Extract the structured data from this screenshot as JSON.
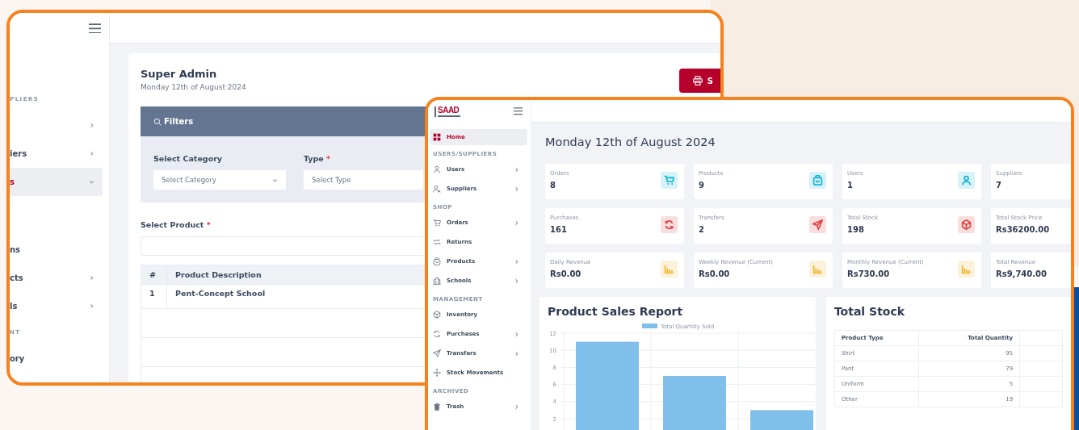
{
  "back_window": {
    "sidebar": {
      "items": [
        {
          "kind": "section",
          "label": "PLIERS"
        },
        {
          "kind": "item",
          "has_submenu": true,
          "expanded": false,
          "selected": false
        },
        {
          "kind": "item",
          "label": "iers",
          "has_submenu": true,
          "expanded": false,
          "selected": false
        },
        {
          "kind": "item",
          "label": "s",
          "has_submenu": true,
          "expanded": true,
          "selected": true
        },
        {
          "kind": "item",
          "label": "ns",
          "has_submenu": false,
          "expanded": false,
          "selected": false
        },
        {
          "kind": "item",
          "label": "cts",
          "has_submenu": true,
          "expanded": false,
          "selected": false
        },
        {
          "kind": "item",
          "label": "ls",
          "has_submenu": true,
          "expanded": false,
          "selected": false
        },
        {
          "kind": "section",
          "label": "NT"
        },
        {
          "kind": "item",
          "label": "ory",
          "has_submenu": false,
          "expanded": false,
          "selected": false
        }
      ]
    },
    "title": "Super Admin",
    "date": "Monday 12th of August 2024",
    "print_button": "S",
    "filters": {
      "title": "Filters",
      "fields": [
        {
          "label": "Select Category",
          "placeholder": "Select Category",
          "dropdown": true
        },
        {
          "label": "Type",
          "required_mark": "*",
          "placeholder": "Select Type",
          "dropdown": false
        }
      ]
    },
    "product_field": {
      "label": "Select Product",
      "required_mark": "*"
    },
    "table": {
      "columns": [
        "#",
        "Product Description"
      ],
      "rows": [
        [
          "1",
          "Pent-Concept School"
        ]
      ]
    }
  },
  "front_window": {
    "logo_text": "SAAD",
    "sidebar": {
      "items": [
        {
          "kind": "item",
          "label": "Home",
          "has_submenu": false,
          "selected": true
        },
        {
          "kind": "section",
          "label": "USERS/SUPPLIERS"
        },
        {
          "kind": "item",
          "label": "Users",
          "has_submenu": true,
          "selected": false
        },
        {
          "kind": "item",
          "label": "Suppliers",
          "has_submenu": true,
          "selected": false
        },
        {
          "kind": "section",
          "label": "SHOP"
        },
        {
          "kind": "item",
          "label": "Orders",
          "has_submenu": true,
          "selected": false
        },
        {
          "kind": "item",
          "label": "Returns",
          "has_submenu": false,
          "selected": false
        },
        {
          "kind": "item",
          "label": "Products",
          "has_submenu": true,
          "selected": false
        },
        {
          "kind": "item",
          "label": "Schools",
          "has_submenu": true,
          "selected": false
        },
        {
          "kind": "section",
          "label": "MANAGEMENT"
        },
        {
          "kind": "item",
          "label": "Inventory",
          "has_submenu": false,
          "selected": false
        },
        {
          "kind": "item",
          "label": "Purchases",
          "has_submenu": true,
          "selected": false
        },
        {
          "kind": "item",
          "label": "Transfers",
          "has_submenu": true,
          "selected": false
        },
        {
          "kind": "item",
          "label": "Stock Movements",
          "has_submenu": false,
          "selected": false
        },
        {
          "kind": "section",
          "label": "ARCHIVED"
        },
        {
          "kind": "item",
          "label": "Trash",
          "has_submenu": true,
          "selected": false
        }
      ]
    },
    "heading": "Monday 12th of August 2024",
    "stats": [
      {
        "label": "Orders",
        "value": "8",
        "color": "#1fb6d6"
      },
      {
        "label": "Products",
        "value": "9",
        "color": "#1fb6d6"
      },
      {
        "label": "Users",
        "value": "1",
        "color": "#1fb6d6"
      },
      {
        "label": "Suppliers",
        "value": "7"
      },
      {
        "label": "Purchases",
        "value": "161",
        "color": "#e34848"
      },
      {
        "label": "Transfers",
        "value": "2",
        "color": "#e34848"
      },
      {
        "label": "Total Stock",
        "value": "198",
        "color": "#e34848"
      },
      {
        "label": "Total Stock Price",
        "value": "Rs36200.00"
      },
      {
        "label": "Daily Revenue",
        "value": "Rs0.00",
        "color": "#f0b93a"
      },
      {
        "label": "Weekly Revenue (Current)",
        "value": "Rs0.00",
        "color": "#f0b93a"
      },
      {
        "label": "Monthly Revenue (Current)",
        "value": "Rs730.00",
        "color": "#f0b93a"
      },
      {
        "label": "Total Revenue",
        "value": "Rs9,740.00"
      }
    ],
    "sales_report": {
      "title": "Product Sales Report",
      "chart_data": {
        "type": "bar",
        "grid": true,
        "series": [
          {
            "name": "Total Quantity Sold",
            "color": "#7fbfea",
            "values": [
              11,
              7,
              3
            ]
          }
        ],
        "ylim": [
          0,
          12
        ],
        "yticks": [
          2,
          4,
          6,
          8,
          10,
          12
        ]
      }
    },
    "total_stock": {
      "title": "Total Stock",
      "columns": [
        "Product Type",
        "Total Quantity"
      ],
      "rows": [
        [
          "Shirt",
          "95"
        ],
        [
          "Pant",
          "79"
        ],
        [
          "Uniform",
          "5"
        ],
        [
          "Other",
          "19"
        ]
      ]
    }
  }
}
